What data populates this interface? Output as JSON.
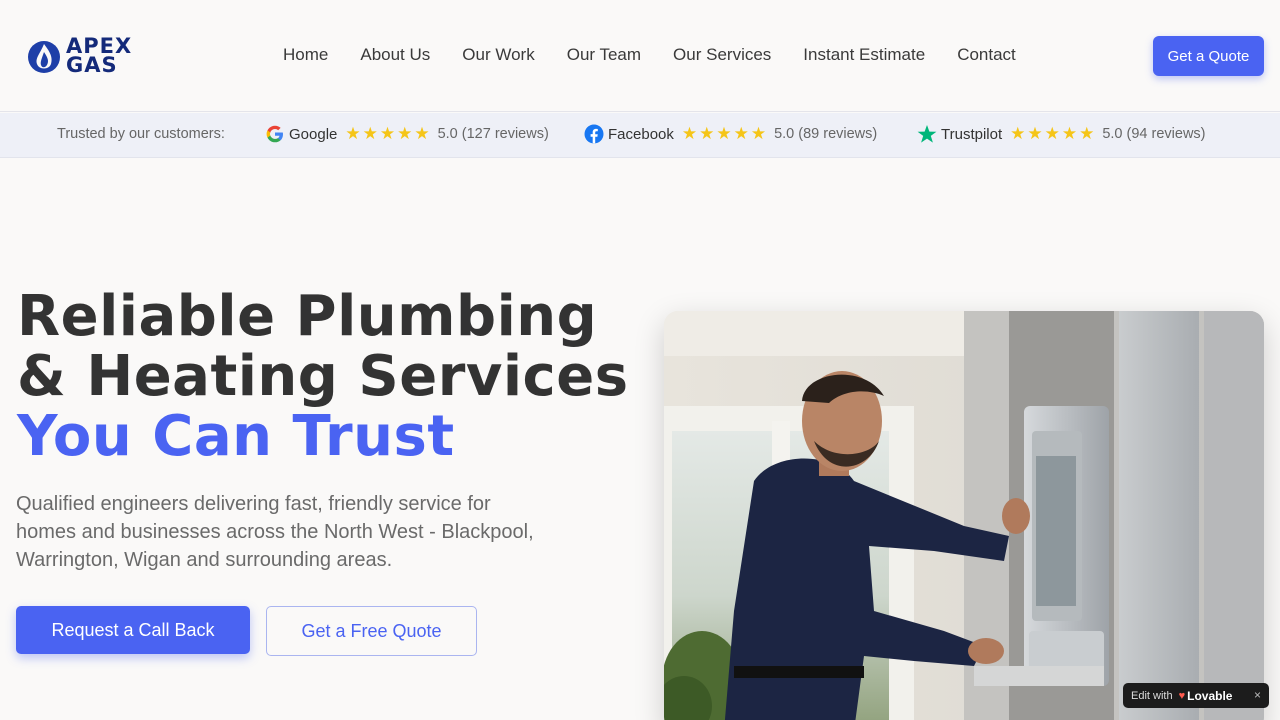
{
  "brand": {
    "line1": "APEX",
    "line2": "GAS",
    "color": "#142a7a",
    "flame_color": "#1e3fa8"
  },
  "nav": {
    "items": [
      {
        "label": "Home"
      },
      {
        "label": "About Us"
      },
      {
        "label": "Our Work"
      },
      {
        "label": "Our Team"
      },
      {
        "label": "Our Services"
      },
      {
        "label": "Instant Estimate"
      },
      {
        "label": "Contact"
      }
    ],
    "cta_label": "Get a Quote"
  },
  "reviews": {
    "trusted_label": "Trusted by our customers:",
    "platforms": [
      {
        "name": "Google",
        "icon": "google-icon",
        "stars": "★★★★★",
        "rating": 5,
        "score": "5.0 (127 reviews)"
      },
      {
        "name": "Facebook",
        "icon": "facebook-icon",
        "stars": "★★★★★",
        "rating": 5,
        "score": "5.0 (89 reviews)"
      },
      {
        "name": "Trustpilot",
        "icon": "trustpilot-star-icon",
        "stars": "★★★★★",
        "rating": 5,
        "score": "5.0 (94 reviews)"
      }
    ],
    "star_color": "#f5c518"
  },
  "hero": {
    "title_line1": "Reliable Plumbing",
    "title_line2": "& Heating Services",
    "title_accent": "You Can Trust",
    "subtitle": "Qualified engineers delivering fast, friendly service for homes and businesses across the North West - Blackpool, Warrington, Wigan and surrounding areas.",
    "primary_button": "Request a Call Back",
    "secondary_button": "Get a Free Quote",
    "accent_color": "#4a63f2"
  },
  "badge": {
    "prefix": "Edit with",
    "brand": "Lovable",
    "close": "×"
  }
}
